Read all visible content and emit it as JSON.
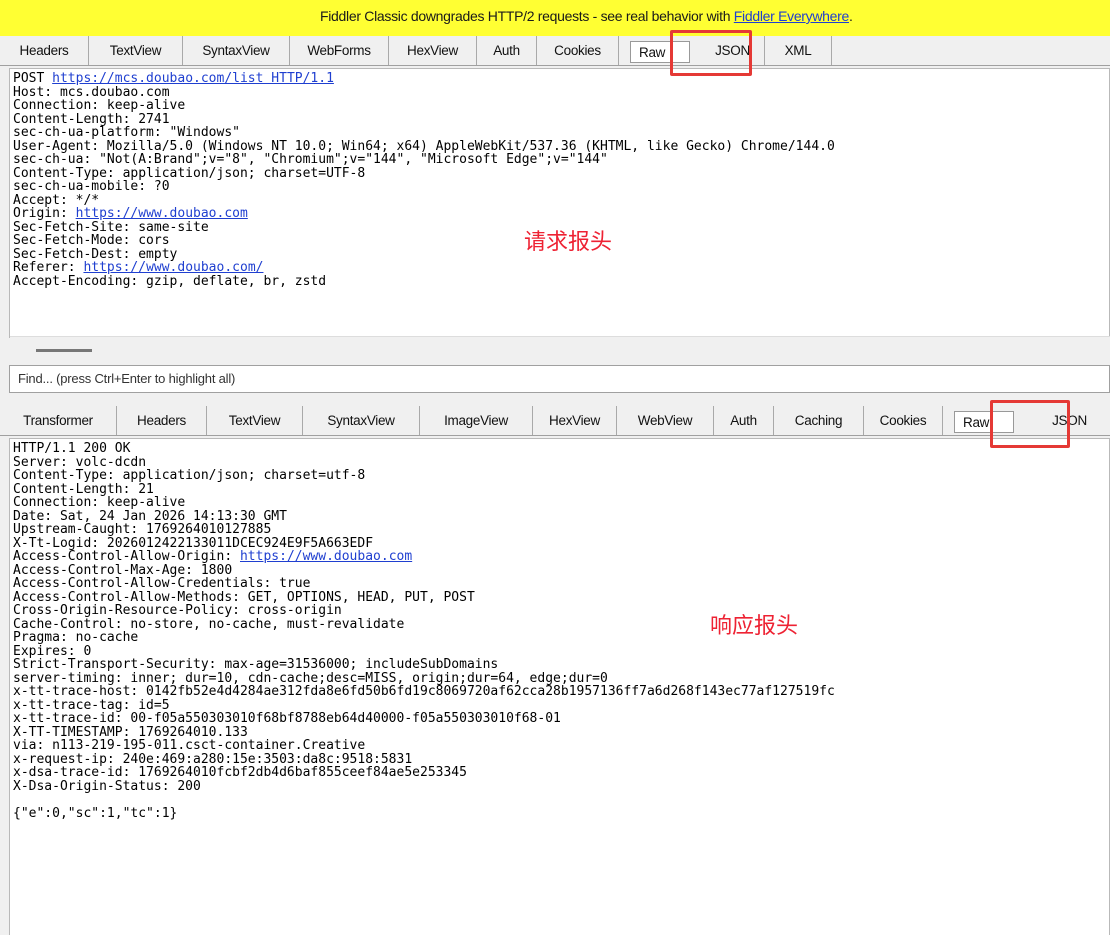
{
  "banner": {
    "text": "Fiddler Classic downgrades HTTP/2 requests - see real behavior with ",
    "link": "Fiddler Everywhere",
    "tail": "."
  },
  "request_tabs": [
    "Headers",
    "TextView",
    "SyntaxView",
    "WebForms",
    "HexView",
    "Auth",
    "Cookies",
    "Raw",
    "JSON",
    "XML"
  ],
  "request_active_tab": "Raw",
  "request": {
    "line_method": "POST ",
    "line_url": "https://mcs.doubao.com/list HTTP/1.1",
    "headers_1": [
      "Host: mcs.doubao.com",
      "Connection: keep-alive",
      "Content-Length: 2741",
      "sec-ch-ua-platform: \"Windows\"",
      "User-Agent: Mozilla/5.0 (Windows NT 10.0; Win64; x64) AppleWebKit/537.36 (KHTML, like Gecko) Chrome/144.0",
      "sec-ch-ua: \"Not(A:Brand\";v=\"8\", \"Chromium\";v=\"144\", \"Microsoft Edge\";v=\"144\"",
      "Content-Type: application/json; charset=UTF-8",
      "sec-ch-ua-mobile: ?0",
      "Accept: */*"
    ],
    "origin_label": "Origin: ",
    "origin_url": "https://www.doubao.com",
    "headers_2": [
      "Sec-Fetch-Site: same-site",
      "Sec-Fetch-Mode: cors",
      "Sec-Fetch-Dest: empty"
    ],
    "referer_label": "Referer: ",
    "referer_url": "https://www.doubao.com/",
    "headers_3": [
      "Accept-Encoding: gzip, deflate, br, zstd"
    ]
  },
  "request_annotation": "请求报头",
  "find_placeholder": "Find... (press Ctrl+Enter to highlight all)",
  "response_tabs": [
    "Transformer",
    "Headers",
    "TextView",
    "SyntaxView",
    "ImageView",
    "HexView",
    "WebView",
    "Auth",
    "Caching",
    "Cookies",
    "Raw",
    "JSON"
  ],
  "response_active_tab": "Raw",
  "response": {
    "headers_1": [
      "HTTP/1.1 200 OK",
      "Server: volc-dcdn",
      "Content-Type: application/json; charset=utf-8",
      "Content-Length: 21",
      "Connection: keep-alive",
      "Date: Sat, 24 Jan 2026 14:13:30 GMT",
      "Upstream-Caught: 1769264010127885",
      "X-Tt-Logid: 2026012422133011DCEC924E9F5A663EDF"
    ],
    "acao_label": "Access-Control-Allow-Origin: ",
    "acao_url": "https://www.doubao.com",
    "headers_2": [
      "Access-Control-Max-Age: 1800",
      "Access-Control-Allow-Credentials: true",
      "Access-Control-Allow-Methods: GET, OPTIONS, HEAD, PUT, POST",
      "Cross-Origin-Resource-Policy: cross-origin",
      "Cache-Control: no-store, no-cache, must-revalidate",
      "Pragma: no-cache",
      "Expires: 0",
      "Strict-Transport-Security: max-age=31536000; includeSubDomains",
      "server-timing: inner; dur=10, cdn-cache;desc=MISS, origin;dur=64, edge;dur=0",
      "x-tt-trace-host: 0142fb52e4d4284ae312fda8e6fd50b6fd19c8069720af62cca28b1957136ff7a6d268f143ec77af127519fc",
      "x-tt-trace-tag: id=5",
      "x-tt-trace-id: 00-f05a550303010f68bf8788eb64d40000-f05a550303010f68-01",
      "X-TT-TIMESTAMP: 1769264010.133",
      "via: n113-219-195-011.csct-container.Creative",
      "x-request-ip: 240e:469:a280:15e:3503:da8c:9518:5831",
      "x-dsa-trace-id: 1769264010fcbf2db4d6baf855ceef84ae5e253345",
      "X-Dsa-Origin-Status: 200"
    ],
    "body": "{\"e\":0,\"sc\":1,\"tc\":1}"
  },
  "response_annotation": "响应报头",
  "colors": {
    "banner": "#ffff33",
    "link": "#1f3fd0",
    "highlight": "#e53935",
    "annotation": "#ee2233"
  }
}
